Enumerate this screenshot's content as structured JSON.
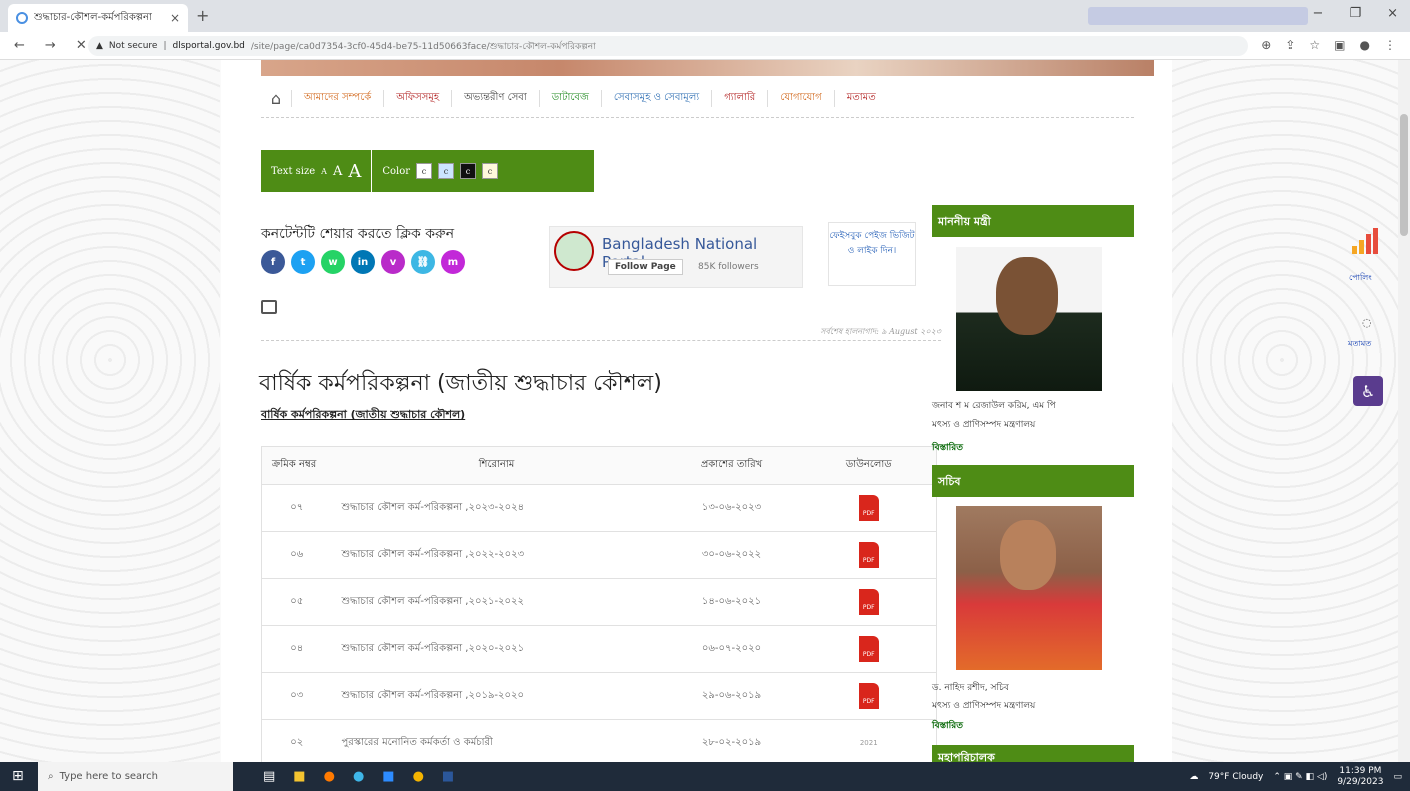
{
  "browser": {
    "tab_title": "শুদ্ধাচার-কৌশল-কর্মপরিকল্পনা",
    "address_warning": "Not secure",
    "address_host": "dlsportal.gov.bd",
    "address_path": "/site/page/ca0d7354-3cf0-45d4-be75-11d50663face/শুদ্ধাচার-কৌশল-কর্মপরিকল্পনা"
  },
  "menu": [
    "আমাদের সম্পর্কে",
    "অফিসসমূহ",
    "অভ্যন্তরীণ সেবা",
    "ডাটাবেজ",
    "সেবাসমূহ ও সেবামূল্য",
    "গ্যালারি",
    "যোগাযোগ",
    "মতামত"
  ],
  "menu_colors": [
    "#d2691e",
    "#b22222",
    "#444444",
    "#228b22",
    "#2f6fb3",
    "#b22222",
    "#d2691e",
    "#b22222"
  ],
  "tools": {
    "text_size": "Text size",
    "a_small": "A",
    "a_med": "A",
    "a_large": "A",
    "color": "Color",
    "c": "c"
  },
  "share": {
    "label": "কনটেন্টটি শেয়ার করতে ক্লিক করুন"
  },
  "facebook": {
    "page_name": "Bangladesh National Portal",
    "follow": "Follow Page",
    "followers": "85K followers"
  },
  "fb_note": "ফেইসবুক পেইজ ভিজিট ও লাইক দিন।",
  "updated": "সর্বশেষ হালনাগাদ: ৯ August ২০২৩",
  "title": "বার্ষিক কর্মপরিকল্পনা (জাতীয় শুদ্ধাচার কৌশল)",
  "subtitle": "বার্ষিক কর্মপরিকল্পনা (জাতীয় শুদ্ধাচার কৌশল)",
  "table": {
    "headers": [
      "ক্রমিক নম্বর",
      "শিরোনাম",
      "প্রকাশের তারিখ",
      "ডাউনলোড"
    ],
    "rows": [
      {
        "no": "০৭",
        "title": "শুদ্ধাচার কৌশল কর্ম-পরিকল্পনা ,২০২৩-২০২৪",
        "date": "১৩-০৬-২০২৩",
        "dl": "PDF"
      },
      {
        "no": "০৬",
        "title": "শুদ্ধাচার কৌশল কর্ম-পরিকল্পনা ,২০২২-২০২৩",
        "date": "৩০-০৬-২০২২",
        "dl": "PDF"
      },
      {
        "no": "০৫",
        "title": "শুদ্ধাচার কৌশল কর্ম-পরিকল্পনা ,২০২১-২০২২",
        "date": "১৪-০৬-২০২১",
        "dl": "PDF"
      },
      {
        "no": "০৪",
        "title": "শুদ্ধাচার কৌশল কর্ম-পরিকল্পনা ,২০২০-২০২১",
        "date": "০৬-০৭-২০২০",
        "dl": "PDF"
      },
      {
        "no": "০৩",
        "title": "শুদ্ধাচার কৌশল কর্ম-পরিকল্পনা ,২০১৯-২০২০",
        "date": "২৯-০৬-২০১৯",
        "dl": "PDF"
      },
      {
        "no": "০২",
        "title": "পুরস্কারের মনোনিত কর্মকর্তা ও কর্মচারী",
        "date": "২৮-০২-২০১৯",
        "dl": "2021"
      }
    ]
  },
  "sidebar": {
    "minister_header": "মাননীয় মন্ত্রী",
    "minister_name": "জনাব শ ম রেজাউল করিম, এম পি",
    "minister_ministry": "মৎস্য ও প্রাণিসম্পদ মন্ত্রণালয়",
    "minister_more": "বিস্তারিত",
    "secretary_header": "সচিব",
    "secretary_name": "ড. নাহিদ রশীদ, সচিব",
    "secretary_ministry": "মৎস্য ও প্রাণিসম্পদ মন্ত্রণালয়",
    "secretary_more": "বিস্তারিত",
    "dg_header": "মহাপরিচালক"
  },
  "widgets": {
    "poll": "পোলিং",
    "feedback": "মতামত"
  },
  "taskbar": {
    "search": "Type here to search",
    "weather": "79°F Cloudy",
    "time": "11:39 PM",
    "date": "9/29/2023"
  }
}
